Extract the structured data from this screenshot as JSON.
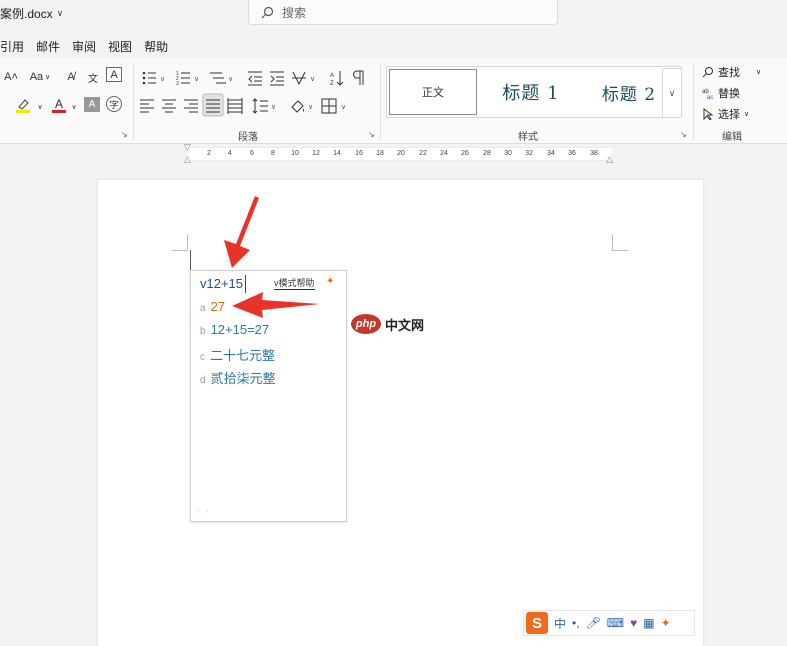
{
  "window": {
    "doc_title": "案例.docx",
    "search_placeholder": "搜索"
  },
  "menu": [
    "引用",
    "邮件",
    "审阅",
    "视图",
    "帮助"
  ],
  "ribbon": {
    "font_glyphs": [
      "A˄",
      "Aa",
      "A"
    ],
    "group_paragraph": "段落",
    "group_styles": "样式",
    "group_editing": "编辑",
    "styles": {
      "normal": "正文",
      "heading1": "标题 1",
      "heading2": "标题 2"
    },
    "editing": {
      "find": "查找",
      "replace": "替换",
      "select": "选择"
    }
  },
  "ruler_ticks": [
    "2",
    "4",
    "6",
    "8",
    "10",
    "12",
    "14",
    "16",
    "18",
    "20",
    "22",
    "24",
    "26",
    "28",
    "30",
    "32",
    "34",
    "36",
    "38"
  ],
  "ime": {
    "input": "v12+15",
    "help_label": "v模式帮助",
    "candidates": [
      {
        "key": "a",
        "text": "27",
        "active": true
      },
      {
        "key": "b",
        "text": "12+15=27",
        "active": false
      },
      {
        "key": "c",
        "text": "二十七元整",
        "active": false
      },
      {
        "key": "d",
        "text": "贰拾柒元整",
        "active": false
      }
    ],
    "active_color": "#d2691e",
    "candidate_color": "#2c7a9e"
  },
  "watermark": {
    "logo": "php",
    "text": "中文网"
  },
  "ime_status": {
    "logo": "S",
    "mode": "中"
  },
  "annotation_color": "#e8332a"
}
